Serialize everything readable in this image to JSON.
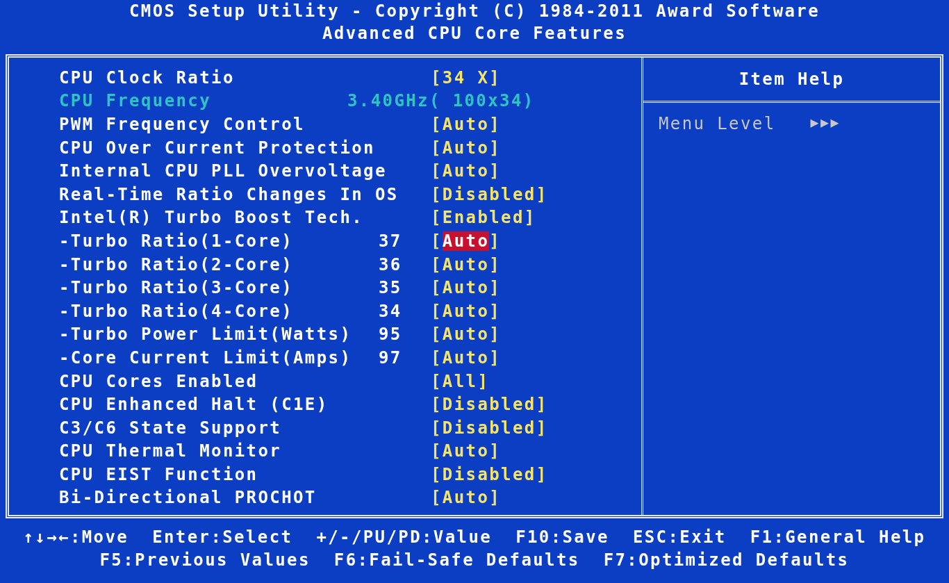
{
  "header": {
    "title": "CMOS Setup Utility - Copyright (C) 1984-2011 Award Software",
    "subtitle": "Advanced CPU Core Features"
  },
  "settings": [
    {
      "kind": "option",
      "label": "CPU Clock Ratio",
      "open": "[",
      "value": "34 X",
      "close": "]",
      "selected": false
    },
    {
      "kind": "info",
      "label": "CPU Frequency",
      "value": "3.40GHz( 100x34)"
    },
    {
      "kind": "option",
      "label": "PWM Frequency Control",
      "open": "[",
      "value": "Auto",
      "close": "]",
      "selected": false
    },
    {
      "kind": "option",
      "label": "CPU Over Current Protection",
      "open": "[",
      "value": "Auto",
      "close": "]",
      "selected": false
    },
    {
      "kind": "option",
      "label": "Internal CPU PLL Overvoltage",
      "open": "[",
      "value": "Auto",
      "close": "]",
      "selected": false
    },
    {
      "kind": "option",
      "label": "Real-Time Ratio Changes In OS",
      "open": "[",
      "value": "Disabled",
      "close": "]",
      "selected": false
    },
    {
      "kind": "option",
      "label": "Intel(R) Turbo Boost Tech.",
      "open": "[",
      "value": "Enabled",
      "close": "]",
      "selected": false
    },
    {
      "kind": "option",
      "label": "-Turbo Ratio(1-Core)",
      "number": "37",
      "open": "[",
      "value": "Auto",
      "close": "]",
      "selected": true
    },
    {
      "kind": "option",
      "label": "-Turbo Ratio(2-Core)",
      "number": "36",
      "open": "[",
      "value": "Auto",
      "close": "]",
      "selected": false
    },
    {
      "kind": "option",
      "label": "-Turbo Ratio(3-Core)",
      "number": "35",
      "open": "[",
      "value": "Auto",
      "close": "]",
      "selected": false
    },
    {
      "kind": "option",
      "label": "-Turbo Ratio(4-Core)",
      "number": "34",
      "open": "[",
      "value": "Auto",
      "close": "]",
      "selected": false
    },
    {
      "kind": "option",
      "label": "-Turbo Power Limit(Watts)",
      "number": "95",
      "open": "[",
      "value": "Auto",
      "close": "]",
      "selected": false
    },
    {
      "kind": "option",
      "label": "-Core Current Limit(Amps)",
      "number": "97",
      "open": "[",
      "value": "Auto",
      "close": "]",
      "selected": false
    },
    {
      "kind": "option",
      "label": "CPU Cores Enabled",
      "open": "[",
      "value": "All",
      "close": "]",
      "selected": false
    },
    {
      "kind": "option",
      "label": "CPU Enhanced Halt (C1E)",
      "open": "[",
      "value": "Disabled",
      "close": "]",
      "selected": false
    },
    {
      "kind": "option",
      "label": "C3/C6 State Support",
      "open": "[",
      "value": "Disabled",
      "close": "]",
      "selected": false
    },
    {
      "kind": "option",
      "label": "CPU Thermal Monitor",
      "open": "[",
      "value": "Auto",
      "close": "]",
      "selected": false
    },
    {
      "kind": "option",
      "label": "CPU EIST Function",
      "open": "[",
      "value": "Disabled",
      "close": "]",
      "selected": false
    },
    {
      "kind": "option",
      "label": "Bi-Directional PROCHOT",
      "open": "[",
      "value": "Auto",
      "close": "]",
      "selected": false
    }
  ],
  "item_help": {
    "title": "Item Help",
    "menu_level_label": "Menu Level",
    "menu_level_marker": "▶▶▶"
  },
  "footer": [
    [
      "↑↓→←:Move",
      "Enter:Select",
      "+/-/PU/PD:Value",
      "F10:Save",
      "ESC:Exit",
      "F1:General Help"
    ],
    [
      "F5:Previous Values",
      "F6:Fail-Safe Defaults",
      "F7:Optimized Defaults"
    ]
  ]
}
